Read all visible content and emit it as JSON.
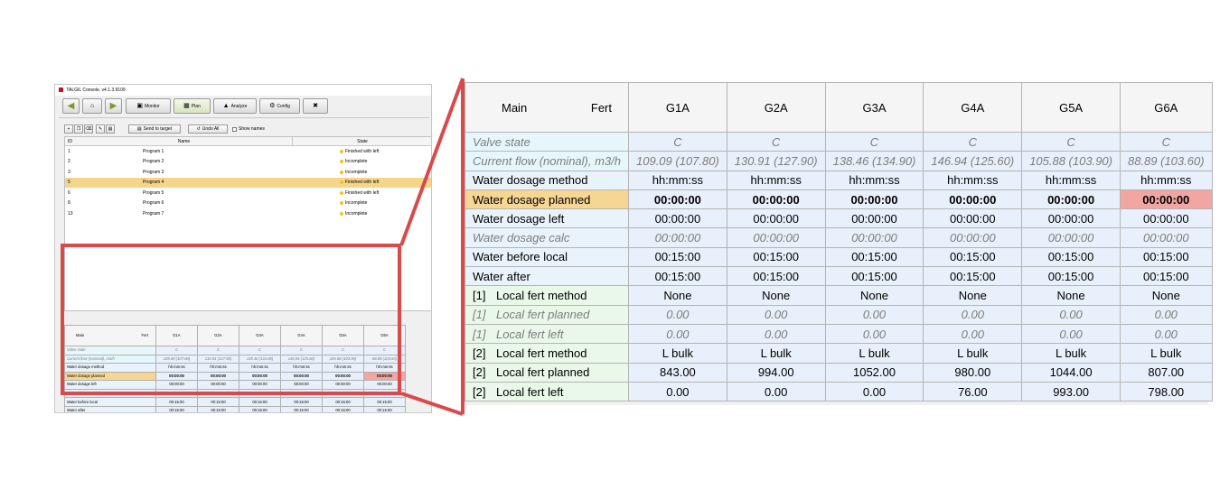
{
  "window": {
    "title": "TALGIL Console, v4.1.3.9109",
    "nav": {
      "back_icon": "arrow-left",
      "home_icon": "home",
      "forward_icon": "arrow-right",
      "monitor": "Monitor",
      "plan": "Plan",
      "analyze": "Analyze",
      "config": "Config",
      "tools_icon": "tools"
    },
    "toolbar": {
      "send_to_target": "Send to target",
      "undo_all": "Undo All",
      "show_names": "Show names"
    }
  },
  "program_list": {
    "columns": [
      "ID",
      "Name",
      "State"
    ],
    "rows": [
      {
        "id": "1",
        "name": "Program 1",
        "state": "Finished with left"
      },
      {
        "id": "2",
        "name": "Program 2",
        "state": "Incomplete"
      },
      {
        "id": "3",
        "name": "Program 3",
        "state": "Incomplete"
      },
      {
        "id": "5",
        "name": "Program 4",
        "state": "Finished with left"
      },
      {
        "id": "6",
        "name": "Program 5",
        "state": "Finished with left"
      },
      {
        "id": "8",
        "name": "Program 6",
        "state": "Incomplete"
      },
      {
        "id": "13",
        "name": "Program 7",
        "state": "Incomplete"
      }
    ],
    "selected_index": 3
  },
  "grid": {
    "header": {
      "main": "Main",
      "fert": "Fert"
    },
    "columns": [
      "G1A",
      "G2A",
      "G3A",
      "G4A",
      "G5A",
      "G6A"
    ],
    "rows": [
      {
        "index": "",
        "label": "Valve state",
        "values": [
          "C",
          "C",
          "C",
          "C",
          "C",
          "C"
        ]
      },
      {
        "index": "",
        "label": "Current flow (nominal), m3/h",
        "values": [
          "109.09 (107.80)",
          "130.91 (127.90)",
          "138.46 (134.90)",
          "146.94 (125.60)",
          "105.88 (103.90)",
          "88.89 (103.60)"
        ]
      },
      {
        "index": "",
        "label": "Water dosage method",
        "values": [
          "hh:mm:ss",
          "hh:mm:ss",
          "hh:mm:ss",
          "hh:mm:ss",
          "hh:mm:ss",
          "hh:mm:ss"
        ]
      },
      {
        "index": "",
        "label": "Water dosage planned",
        "values": [
          "00:00:00",
          "00:00:00",
          "00:00:00",
          "00:00:00",
          "00:00:00",
          "00:00:00"
        ]
      },
      {
        "index": "",
        "label": "Water dosage left",
        "values": [
          "00:00:00",
          "00:00:00",
          "00:00:00",
          "00:00:00",
          "00:00:00",
          "00:00:00"
        ]
      },
      {
        "index": "",
        "label": "Water dosage calc",
        "values": [
          "00:00:00",
          "00:00:00",
          "00:00:00",
          "00:00:00",
          "00:00:00",
          "00:00:00"
        ]
      },
      {
        "index": "",
        "label": "Water before local",
        "values": [
          "00:15:00",
          "00:15:00",
          "00:15:00",
          "00:15:00",
          "00:15:00",
          "00:15:00"
        ]
      },
      {
        "index": "",
        "label": "Water after",
        "values": [
          "00:15:00",
          "00:15:00",
          "00:15:00",
          "00:15:00",
          "00:15:00",
          "00:15:00"
        ]
      },
      {
        "index": "[1]",
        "label": "Local fert method",
        "values": [
          "None",
          "None",
          "None",
          "None",
          "None",
          "None"
        ]
      },
      {
        "index": "[1]",
        "label": "Local fert planned",
        "values": [
          "0.00",
          "0.00",
          "0.00",
          "0.00",
          "0.00",
          "0.00"
        ]
      },
      {
        "index": "[1]",
        "label": "Local fert left",
        "values": [
          "0.00",
          "0.00",
          "0.00",
          "0.00",
          "0.00",
          "0.00"
        ]
      },
      {
        "index": "[2]",
        "label": "Local fert method",
        "values": [
          "L bulk",
          "L bulk",
          "L bulk",
          "L bulk",
          "L bulk",
          "L bulk"
        ]
      },
      {
        "index": "[2]",
        "label": "Local fert planned",
        "values": [
          "843.00",
          "994.00",
          "1052.00",
          "980.00",
          "1044.00",
          "807.00"
        ]
      },
      {
        "index": "[2]",
        "label": "Local fert left",
        "values": [
          "0.00",
          "0.00",
          "0.00",
          "76.00",
          "993.00",
          "798.00"
        ]
      }
    ],
    "highlight_color": "#f2a6a2",
    "selection_color": "#f7d592",
    "callout_color": "#d94a4a"
  }
}
